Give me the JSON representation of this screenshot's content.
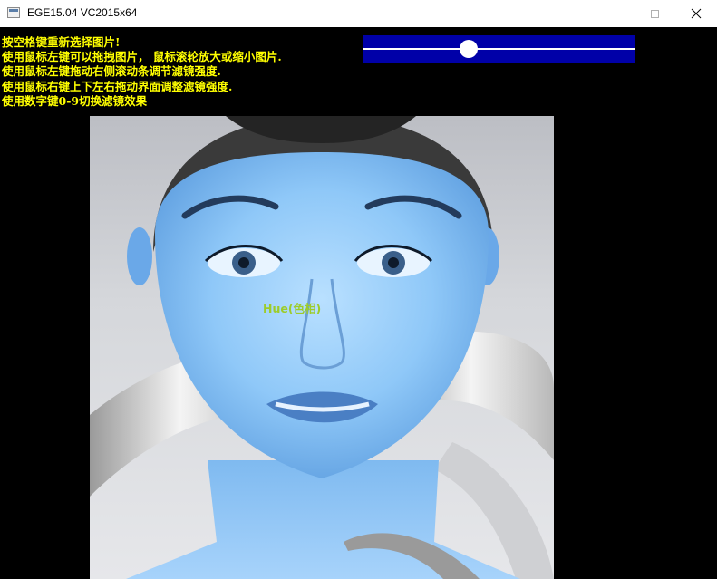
{
  "window": {
    "title": "EGE15.04 VC2015x64"
  },
  "help_lines": [
    "按空格键重新选择图片!",
    "使用鼠标左键可以拖拽图片， 鼠标滚轮放大或缩小图片.",
    "使用鼠标左键拖动右侧滚动条调节滤镜强度.",
    "使用鼠标右键上下左右拖动界面调整滤镜强度.",
    "使用数字键0-9切换滤镜效果"
  ],
  "slider": {
    "value": 0.39
  },
  "filter": {
    "label": "Hue(色相)"
  },
  "colors": {
    "help_text": "#ffff00",
    "slider_track": "#0000a8",
    "filter_label": "#9dcc2a",
    "skin_tint": "#8fc8f8"
  },
  "icons": {
    "app": "window-app-icon",
    "minimize": "minimize-icon",
    "maximize": "maximize-icon",
    "close": "close-icon"
  }
}
